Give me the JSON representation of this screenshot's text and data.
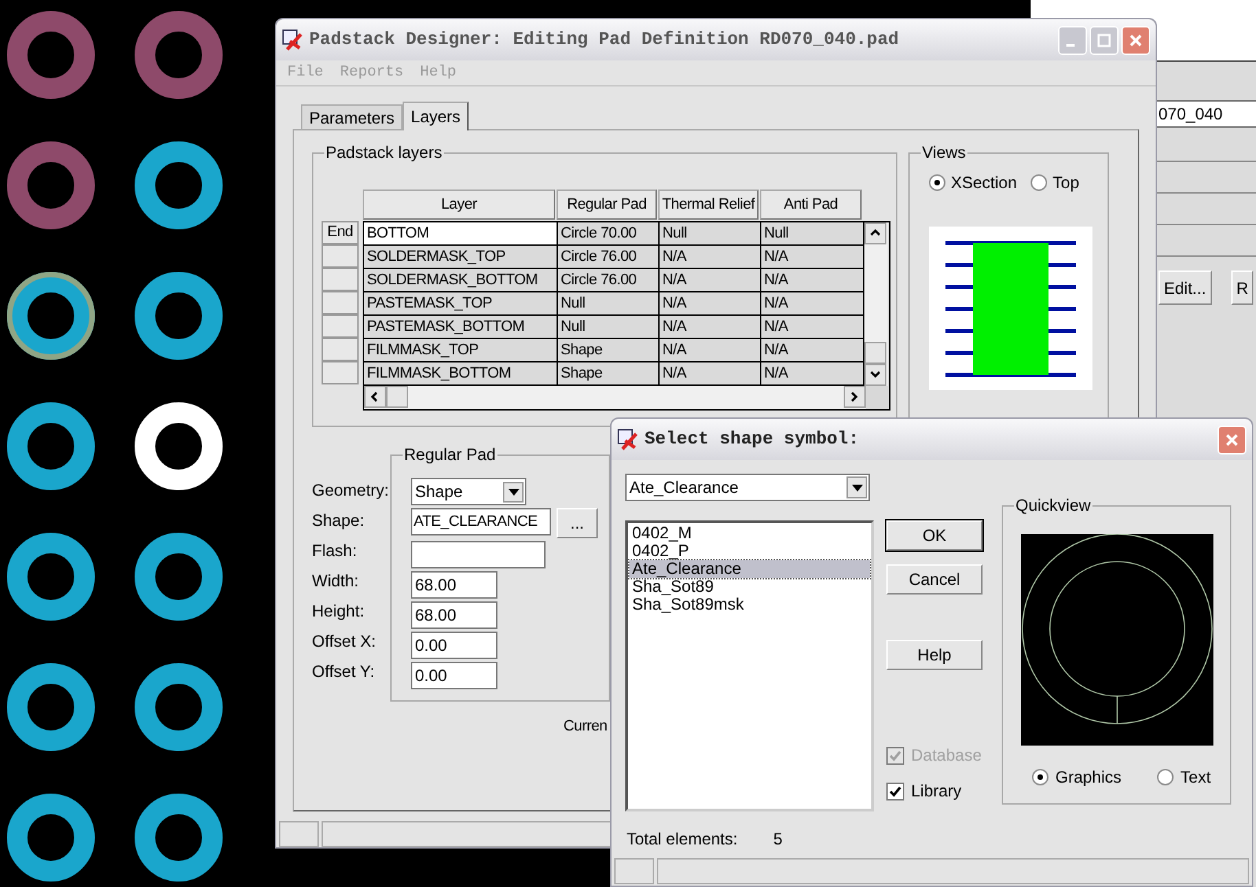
{
  "pcb_canvas": {
    "pads": [
      {
        "color": "#8e4a6a"
      },
      {
        "color": "#8e4a6a"
      },
      {
        "color": "#8e4a6a"
      },
      {
        "color": "#1aa6cc"
      },
      {
        "color": "#1aa6cc",
        "kind": "outlined"
      },
      {
        "color": "#1aa6cc"
      },
      {
        "color": "#1aa6cc"
      },
      {
        "color": "#ffffff"
      },
      {
        "color": "#1aa6cc"
      },
      {
        "color": "#1aa6cc"
      },
      {
        "color": "#1aa6cc"
      },
      {
        "color": "#1aa6cc"
      },
      {
        "color": "#1aa6cc"
      },
      {
        "color": "#1aa6cc"
      }
    ]
  },
  "background_window": {
    "field_value": "070_040",
    "buttons": [
      "Edit...",
      "R"
    ]
  },
  "main_window": {
    "title": "Padstack Designer: Editing Pad Definition RD070_040.pad",
    "menu": [
      {
        "label": "File"
      },
      {
        "label": "Reports"
      },
      {
        "label": "Help"
      }
    ],
    "tabs": [
      {
        "label": "Parameters",
        "selected": false
      },
      {
        "label": "Layers",
        "selected": true
      }
    ],
    "padstack_layers": {
      "title": "Padstack layers",
      "columns": [
        "Layer",
        "Regular Pad",
        "Thermal Relief",
        "Anti Pad"
      ],
      "rows": [
        {
          "marker": "End",
          "selected": true,
          "cells": [
            "BOTTOM",
            "Circle 70.00",
            "Null",
            "Null"
          ]
        },
        {
          "selected": false,
          "cells": [
            "SOLDERMASK_TOP",
            "Circle 76.00",
            "N/A",
            "N/A"
          ]
        },
        {
          "selected": false,
          "cells": [
            "SOLDERMASK_BOTTOM",
            "Circle 76.00",
            "N/A",
            "N/A"
          ]
        },
        {
          "selected": false,
          "cells": [
            "PASTEMASK_TOP",
            "Null",
            "N/A",
            "N/A"
          ]
        },
        {
          "selected": false,
          "cells": [
            "PASTEMASK_BOTTOM",
            "Null",
            "N/A",
            "N/A"
          ]
        },
        {
          "selected": false,
          "cells": [
            "FILMMASK_TOP",
            "Shape",
            "N/A",
            "N/A"
          ]
        },
        {
          "selected": false,
          "cells": [
            "FILMMASK_BOTTOM",
            "Shape",
            "N/A",
            "N/A"
          ]
        }
      ]
    },
    "views": {
      "title": "Views",
      "options": [
        {
          "label": "XSection",
          "selected": true
        },
        {
          "label": "Top",
          "selected": false
        }
      ]
    },
    "regular_pad": {
      "title": "Regular Pad",
      "fields": [
        {
          "label": "Geometry:",
          "kind": "dropdown",
          "value": "Shape"
        },
        {
          "label": "Shape:",
          "kind": "browse",
          "value": "ATE_CLEARANCE",
          "button": "..."
        },
        {
          "label": "Flash:",
          "kind": "wide"
        },
        {
          "label": "Width:",
          "kind": "text",
          "value": "68.00"
        },
        {
          "label": "Height:",
          "kind": "text",
          "value": "68.00"
        },
        {
          "label": "Offset X:",
          "kind": "text",
          "value": "0.00"
        },
        {
          "label": "Offset Y:",
          "kind": "text",
          "value": "0.00"
        }
      ]
    },
    "current_label": "Curren"
  },
  "dialog": {
    "title": "Select shape symbol:",
    "combo_value": "Ate_Clearance",
    "items": [
      {
        "label": "0402_M",
        "selected": false
      },
      {
        "label": "0402_P",
        "selected": false
      },
      {
        "label": "Ate_Clearance",
        "selected": true
      },
      {
        "label": "Sha_Sot89",
        "selected": false
      },
      {
        "label": "Sha_Sot89msk",
        "selected": false
      }
    ],
    "buttons": [
      {
        "label": "OK",
        "default": true
      },
      {
        "label": "Cancel",
        "default": false
      },
      {
        "label": "Help",
        "default": false
      }
    ],
    "checkboxes": [
      {
        "label": "Database",
        "checked": true,
        "disabled": true
      },
      {
        "label": "Library",
        "checked": true,
        "disabled": false
      }
    ],
    "quickview": {
      "title": "Quickview",
      "options": [
        {
          "label": "Graphics",
          "selected": true
        },
        {
          "label": "Text",
          "selected": false
        }
      ]
    },
    "total_label": "Total elements:",
    "total_value": "5"
  }
}
